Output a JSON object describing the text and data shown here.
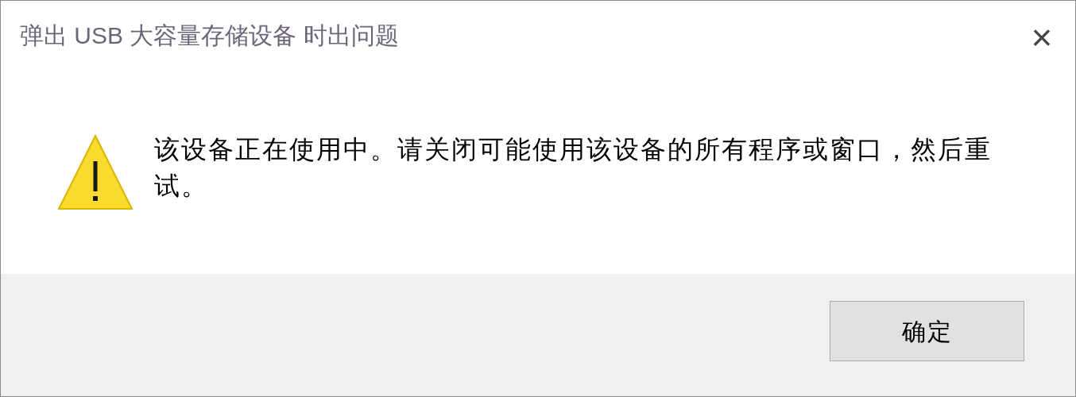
{
  "window": {
    "title": "弹出 USB 大容量存储设备 时出问题",
    "close": "×"
  },
  "message": {
    "kind": "warning",
    "text": "该设备正在使用中。请关闭可能使用该设备的所有程序或窗口，然后重试。"
  },
  "buttons": [
    {
      "label": "确定"
    }
  ]
}
